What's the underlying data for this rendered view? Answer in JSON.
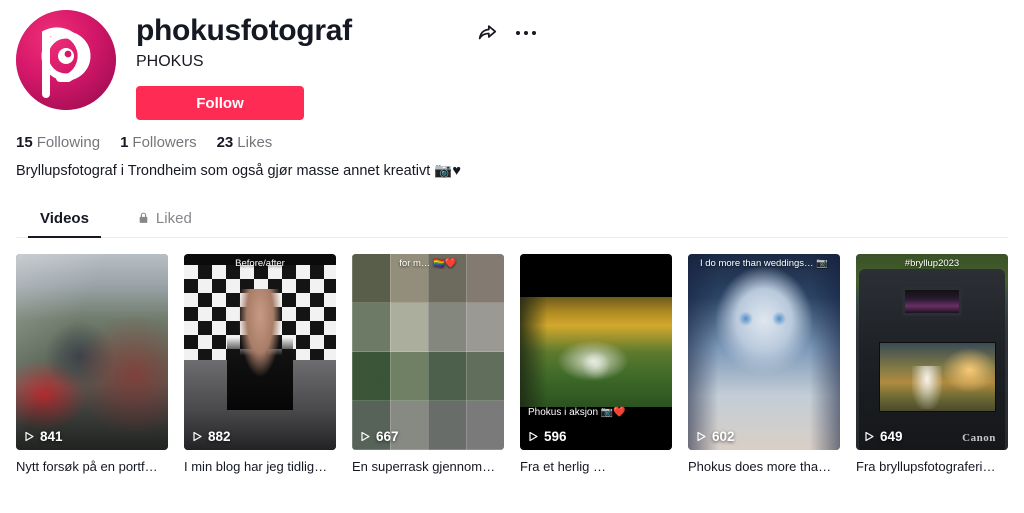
{
  "profile": {
    "username": "phokusfotograf",
    "handle": "PHOKUS",
    "follow_label": "Follow",
    "avatar_alt": "phokus-logo",
    "accent_color": "#FE2C55",
    "stats": [
      {
        "value": "15",
        "label": "Following"
      },
      {
        "value": "1",
        "label": "Followers"
      },
      {
        "value": "23",
        "label": "Likes"
      }
    ],
    "bio": "Bryllupsfotograf i Trondheim som også gjør masse annet kreativt 📷♥"
  },
  "header_actions": {
    "share_icon": "share-arrow-icon",
    "more_icon": "more-options-icon"
  },
  "tabs": [
    {
      "label": "Videos",
      "active": true,
      "locked": false
    },
    {
      "label": "Liked",
      "active": false,
      "locked": true
    }
  ],
  "videos": [
    {
      "views": "841",
      "caption": "Nytt forsøk på en portf…",
      "top_text": "",
      "overlay_text": ""
    },
    {
      "views": "882",
      "caption": "I min blog har jeg tidlig…",
      "top_text": "Before/after",
      "overlay_text": ""
    },
    {
      "views": "667",
      "caption": "En superrask gjennom…",
      "top_text": "for m… 🏳️‍🌈❤️",
      "overlay_text": ""
    },
    {
      "views": "596",
      "caption": "Fra et herlig …",
      "top_text": "",
      "overlay_text": "Phokus i aksjon 📷❤️"
    },
    {
      "views": "602",
      "caption": "Phokus does more tha…",
      "top_text": "I do more than weddings… 📷",
      "overlay_text": ""
    },
    {
      "views": "649",
      "caption": "Fra bryllupsfotograferi…",
      "top_text": "#bryllup2023",
      "overlay_text": ""
    }
  ],
  "camera_brand": "Canon"
}
